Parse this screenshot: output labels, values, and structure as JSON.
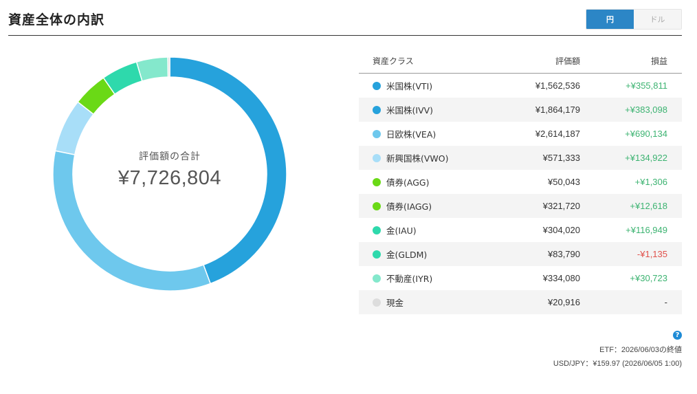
{
  "header": {
    "title": "資産全体の内訳",
    "toggle": {
      "yen": "円",
      "dollar": "ドル",
      "selected": "円"
    }
  },
  "summary": {
    "label": "評価額の合計",
    "total": "¥7,726,804"
  },
  "table": {
    "headers": {
      "name": "資産クラス",
      "value": "評価額",
      "pl": "損益"
    },
    "rows": [
      {
        "name": "米国株(VTI)",
        "value": "¥1,562,536",
        "pl": "+¥355,811",
        "color": "#26a2dc"
      },
      {
        "name": "米国株(IVV)",
        "value": "¥1,864,179",
        "pl": "+¥383,098",
        "color": "#26a2dc"
      },
      {
        "name": "日欧株(VEA)",
        "value": "¥2,614,187",
        "pl": "+¥690,134",
        "color": "#6ec8ed"
      },
      {
        "name": "新興国株(VWO)",
        "value": "¥571,333",
        "pl": "+¥134,922",
        "color": "#a8def8"
      },
      {
        "name": "債券(AGG)",
        "value": "¥50,043",
        "pl": "+¥1,306",
        "color": "#6ad916"
      },
      {
        "name": "債券(IAGG)",
        "value": "¥321,720",
        "pl": "+¥12,618",
        "color": "#6ad916"
      },
      {
        "name": "金(IAU)",
        "value": "¥304,020",
        "pl": "+¥116,949",
        "color": "#2ed9ac"
      },
      {
        "name": "金(GLDM)",
        "value": "¥83,790",
        "pl": "-¥1,135",
        "color": "#2ed9ac"
      },
      {
        "name": "不動産(IYR)",
        "value": "¥334,080",
        "pl": "+¥30,723",
        "color": "#84e8cc"
      },
      {
        "name": "現金",
        "value": "¥20,916",
        "pl": "-",
        "color": "#dddddd"
      }
    ]
  },
  "chart_data": {
    "type": "pie",
    "style": "donut",
    "categories": [
      "米国株",
      "日欧株",
      "新興国株",
      "債券",
      "金",
      "不動産",
      "現金"
    ],
    "values": [
      3426715,
      2614187,
      571333,
      371763,
      387810,
      334080,
      20916
    ],
    "colors": [
      "#26a2dc",
      "#6ec8ed",
      "#a8def8",
      "#6ad916",
      "#2ed9ac",
      "#84e8cc",
      "#dddddd"
    ]
  },
  "footer": {
    "help_icon": "question-circle-icon",
    "help_glyph": "?",
    "etf_note": "ETF：2026/06/03の終値",
    "fx_note": "USD/JPY：¥159.97 (2026/06/05 1:00)"
  }
}
